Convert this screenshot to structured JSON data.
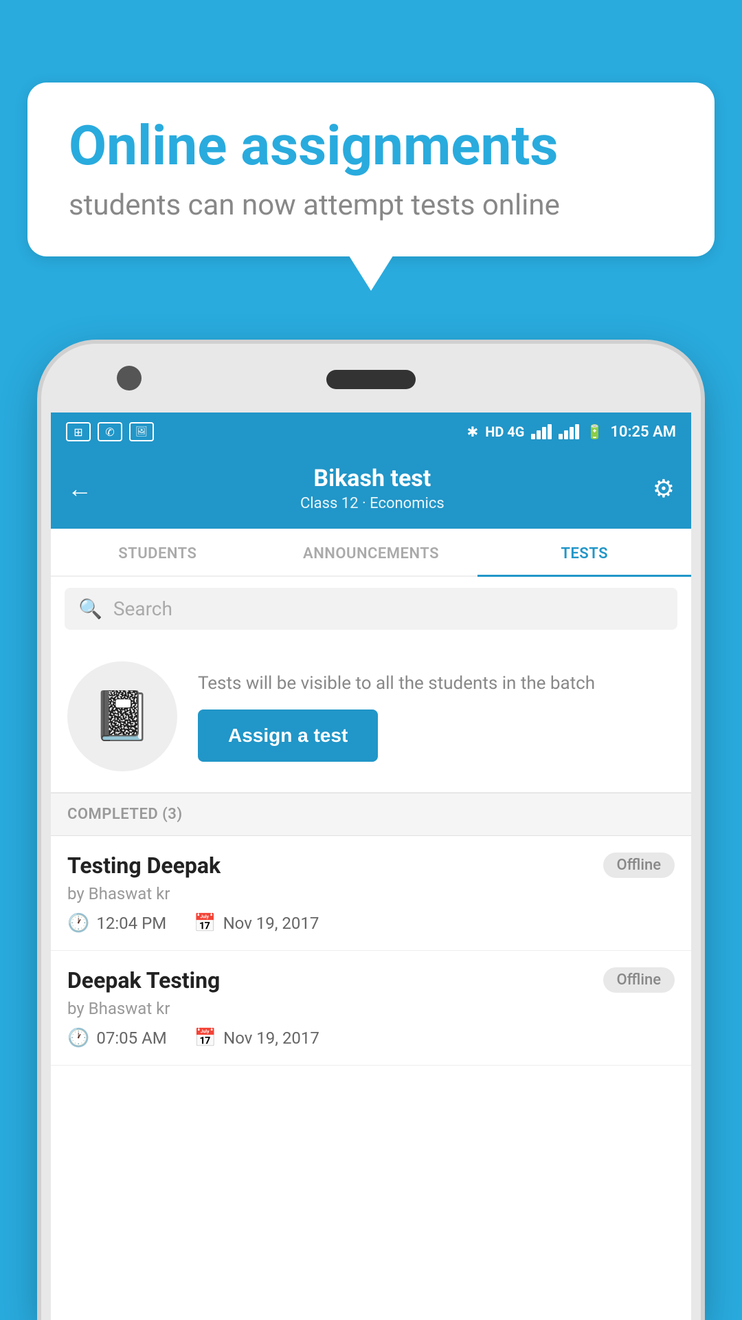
{
  "background": {
    "color": "#29ABDE"
  },
  "bubble": {
    "title": "Online assignments",
    "subtitle": "students can now attempt tests online"
  },
  "statusBar": {
    "time": "10:25 AM",
    "network": "HD 4G",
    "icons": [
      "app-icon",
      "whatsapp-icon",
      "image-icon"
    ]
  },
  "header": {
    "title": "Bikash test",
    "subtitle": "Class 12 · Economics",
    "backLabel": "←",
    "settingsLabel": "⚙"
  },
  "tabs": [
    {
      "label": "STUDENTS",
      "active": false
    },
    {
      "label": "ANNOUNCEMENTS",
      "active": false
    },
    {
      "label": "TESTS",
      "active": true
    }
  ],
  "search": {
    "placeholder": "Search"
  },
  "assignSection": {
    "description": "Tests will be visible to all the students in the batch",
    "buttonLabel": "Assign a test"
  },
  "completedSection": {
    "header": "COMPLETED (3)",
    "items": [
      {
        "title": "Testing Deepak",
        "author": "by Bhaswat kr",
        "time": "12:04 PM",
        "date": "Nov 19, 2017",
        "badge": "Offline"
      },
      {
        "title": "Deepak Testing",
        "author": "by Bhaswat kr",
        "time": "07:05 AM",
        "date": "Nov 19, 2017",
        "badge": "Offline"
      }
    ]
  }
}
